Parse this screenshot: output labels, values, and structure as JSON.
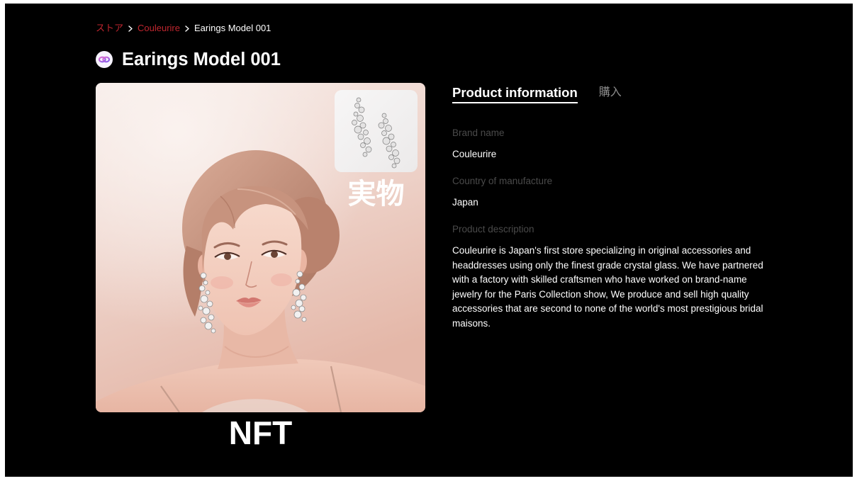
{
  "breadcrumb": {
    "items": [
      {
        "label": "ストア",
        "link": true
      },
      {
        "label": "Couleurire",
        "link": true
      },
      {
        "label": "Earings Model 001",
        "link": false
      }
    ],
    "separator_icon": "chevron-right-icon"
  },
  "header": {
    "title": "Earings Model 001",
    "chain_icon": "polygon-icon"
  },
  "media": {
    "inset_caption": "実物",
    "main_caption": "NFT"
  },
  "tabs": [
    {
      "label": "Product information",
      "active": true
    },
    {
      "label": "購入",
      "active": false
    }
  ],
  "product": {
    "brand_label": "Brand name",
    "brand": "Couleurire",
    "country_label": "Country of manufacture",
    "country": "Japan",
    "description_label": "Product description",
    "description": "Couleurire is Japan's first store specializing in original accessories and headdresses using only the finest grade crystal glass. We have partnered with a factory with skilled craftsmen who have worked on brand-name jewelry for the Paris Collection show, We produce and sell high quality accessories that are second to none of the world's most prestigious bridal maisons."
  },
  "colors": {
    "background": "#000000",
    "accent": "#c0262f",
    "text": "#ffffff",
    "muted": "#4a4a4a",
    "tab_inactive": "#8c8c8c"
  }
}
